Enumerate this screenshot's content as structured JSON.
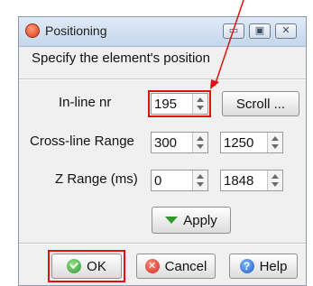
{
  "window": {
    "title": "Positioning",
    "controls": {
      "minimize": "▭",
      "maximize": "▣",
      "close": "✕"
    }
  },
  "subtitle": "Specify the element's position",
  "inline": {
    "label": "In-line nr",
    "value": "195",
    "scroll_label": "Scroll ..."
  },
  "crossline": {
    "label": "Cross-line Range",
    "from": "300",
    "to": "1250"
  },
  "zrange": {
    "label": "Z Range (ms)",
    "from": "0",
    "to": "1848"
  },
  "apply_label": "Apply",
  "footer": {
    "ok_label": "OK",
    "cancel_label": "Cancel",
    "help_label": "Help",
    "help_icon_glyph": "?"
  },
  "annotations": {
    "highlight_color": "#e01010",
    "arrow_color": "#e01010"
  }
}
